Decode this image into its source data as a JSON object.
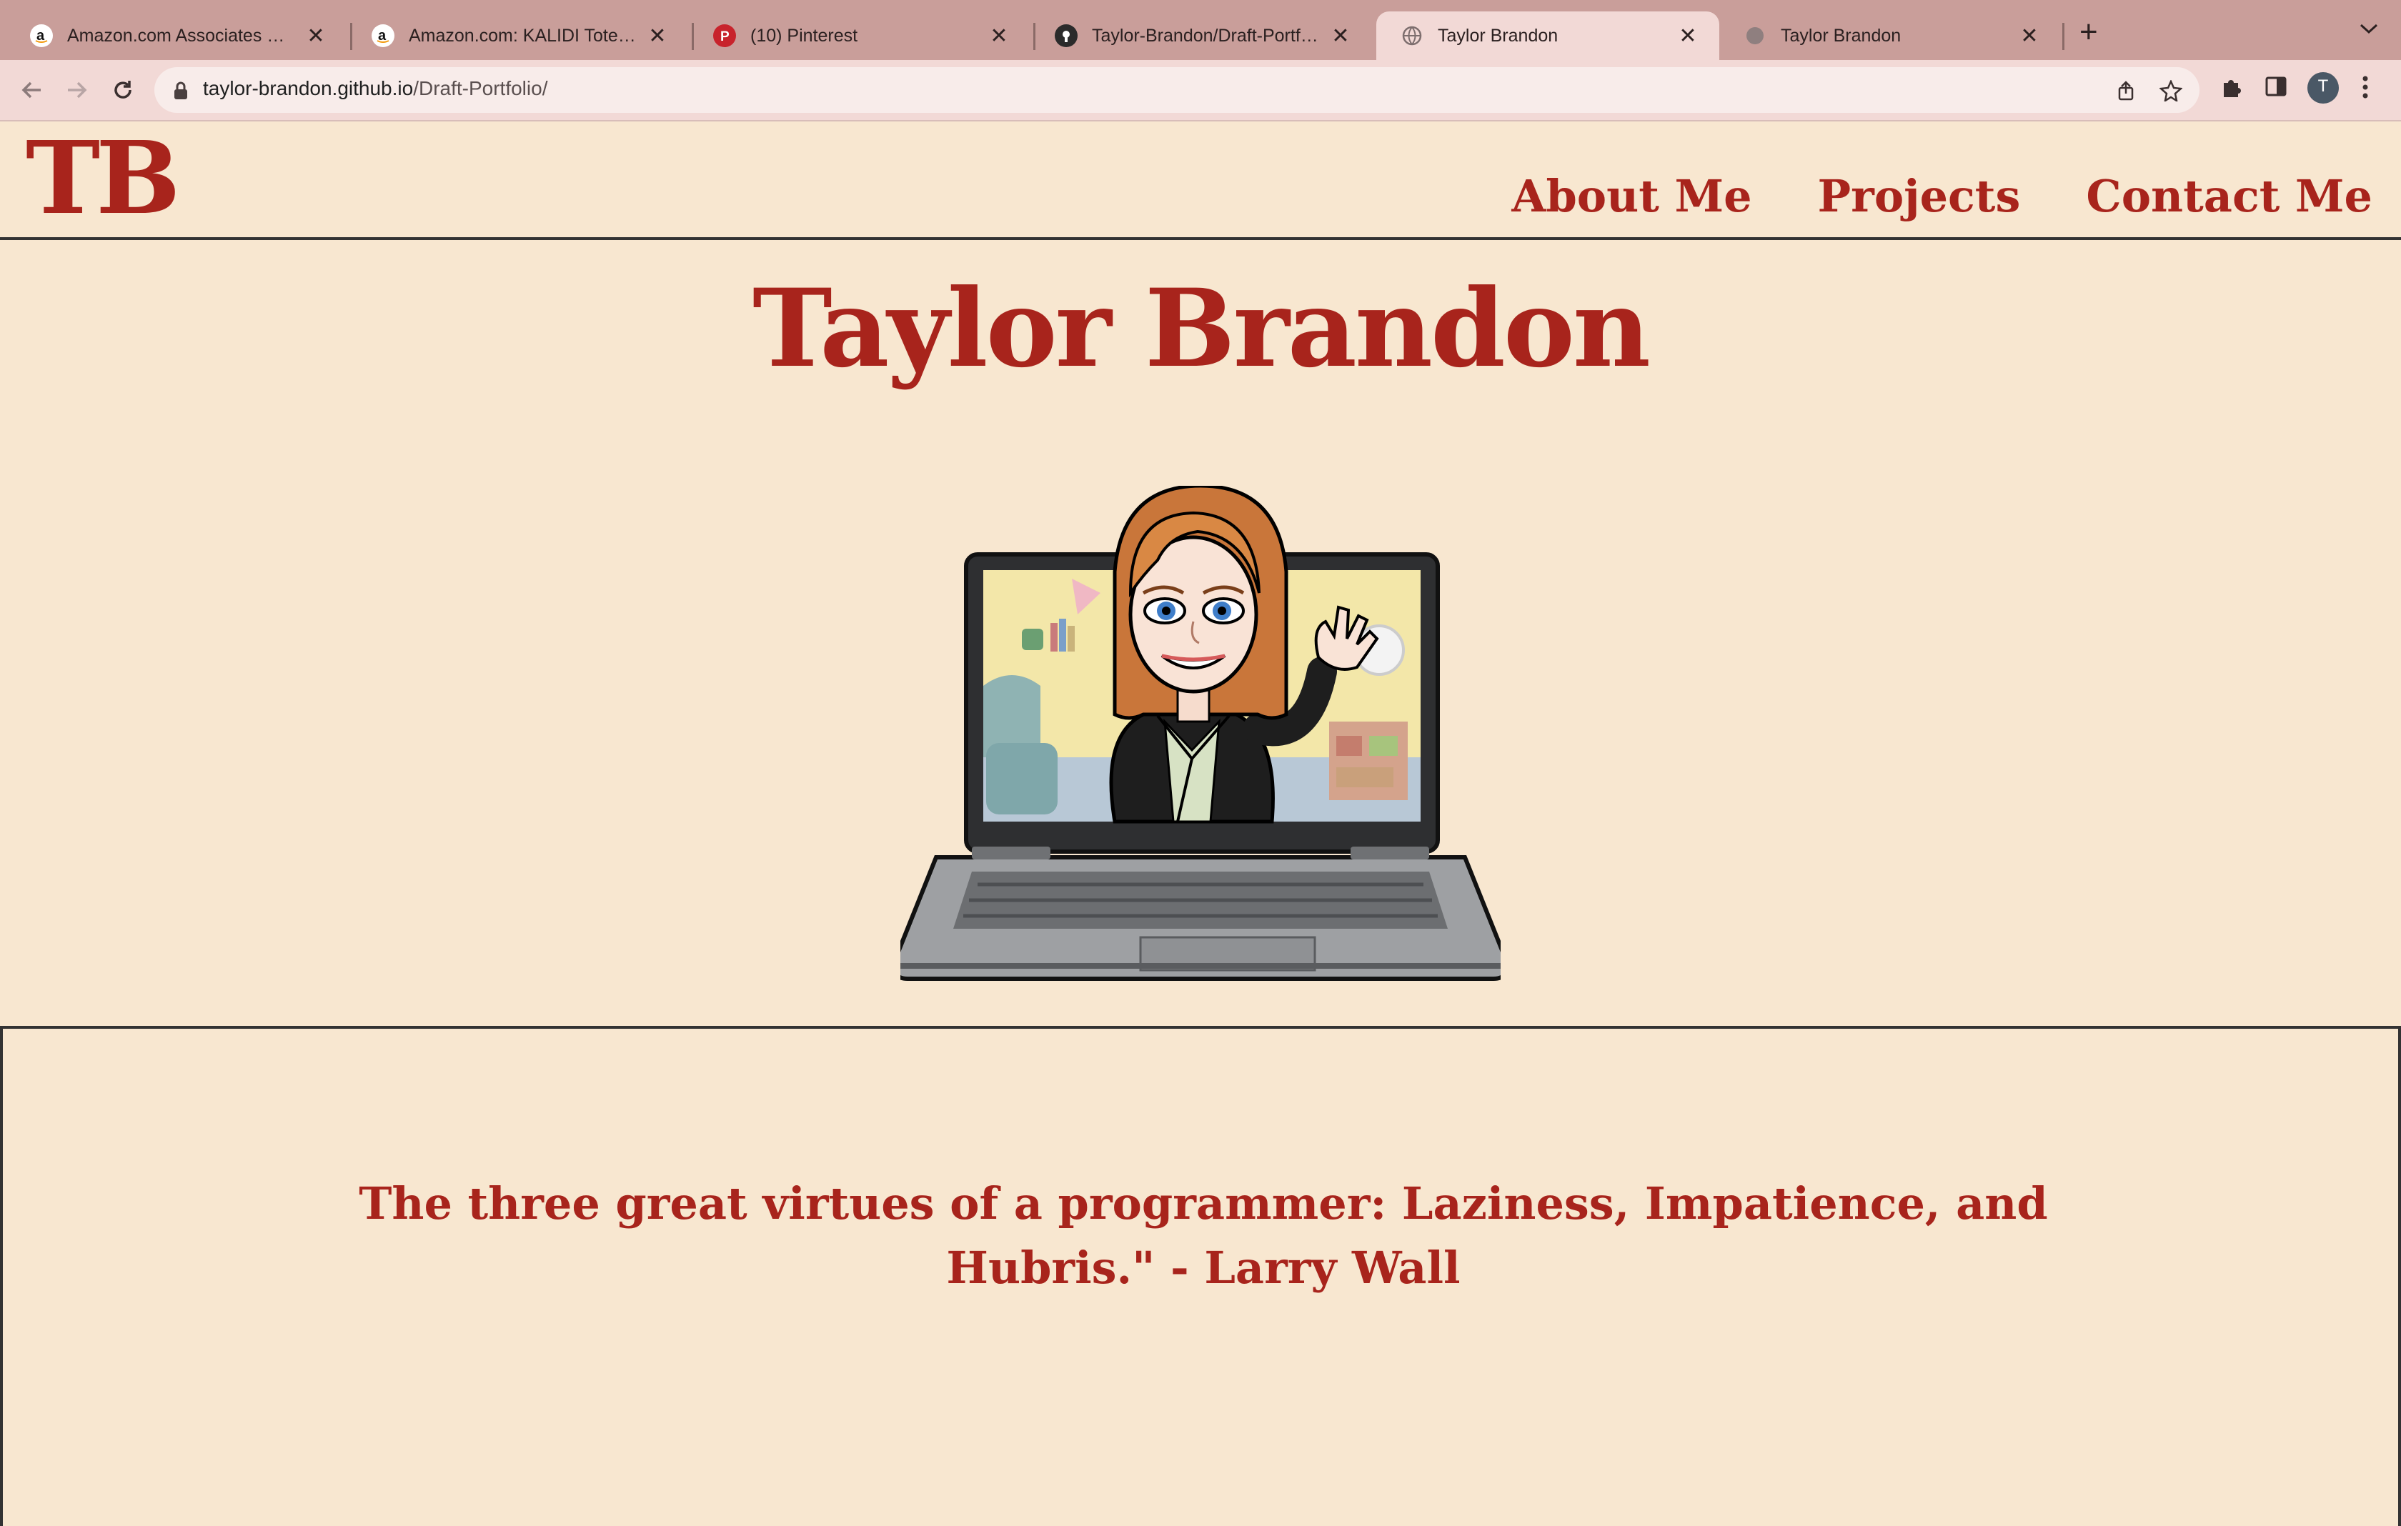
{
  "browser": {
    "tabs": [
      {
        "title": "Amazon.com Associates Central",
        "favicon": "amazon-icon",
        "active": false
      },
      {
        "title": "Amazon.com: KALIDI Tote Bag",
        "favicon": "amazon-icon",
        "active": false
      },
      {
        "title": "(10) Pinterest",
        "favicon": "pinterest-icon",
        "active": false
      },
      {
        "title": "Taylor-Brandon/Draft-Portfolio",
        "favicon": "github-icon",
        "active": false
      },
      {
        "title": "Taylor Brandon",
        "favicon": "globe-icon",
        "active": true
      },
      {
        "title": "Taylor Brandon",
        "favicon": "globe-icon",
        "active": false
      }
    ],
    "url_host": "taylor-brandon.github.io",
    "url_path": "/Draft-Portfolio/",
    "profile_initial": "T",
    "colors": {
      "tabstrip": "#c99e9a",
      "toolbar": "#f2d9d6"
    }
  },
  "site": {
    "logo": "TB",
    "nav": [
      "About Me",
      "Projects",
      "Contact Me"
    ],
    "title": "Taylor Brandon",
    "avatar_icon": "bitmoji-laptop-avatar",
    "quote": "The three great virtues of a programmer: Laziness, Impatience, and Hubris.\" - Larry Wall",
    "colors": {
      "background": "#f8e7d0",
      "accent": "#a8241c"
    }
  }
}
